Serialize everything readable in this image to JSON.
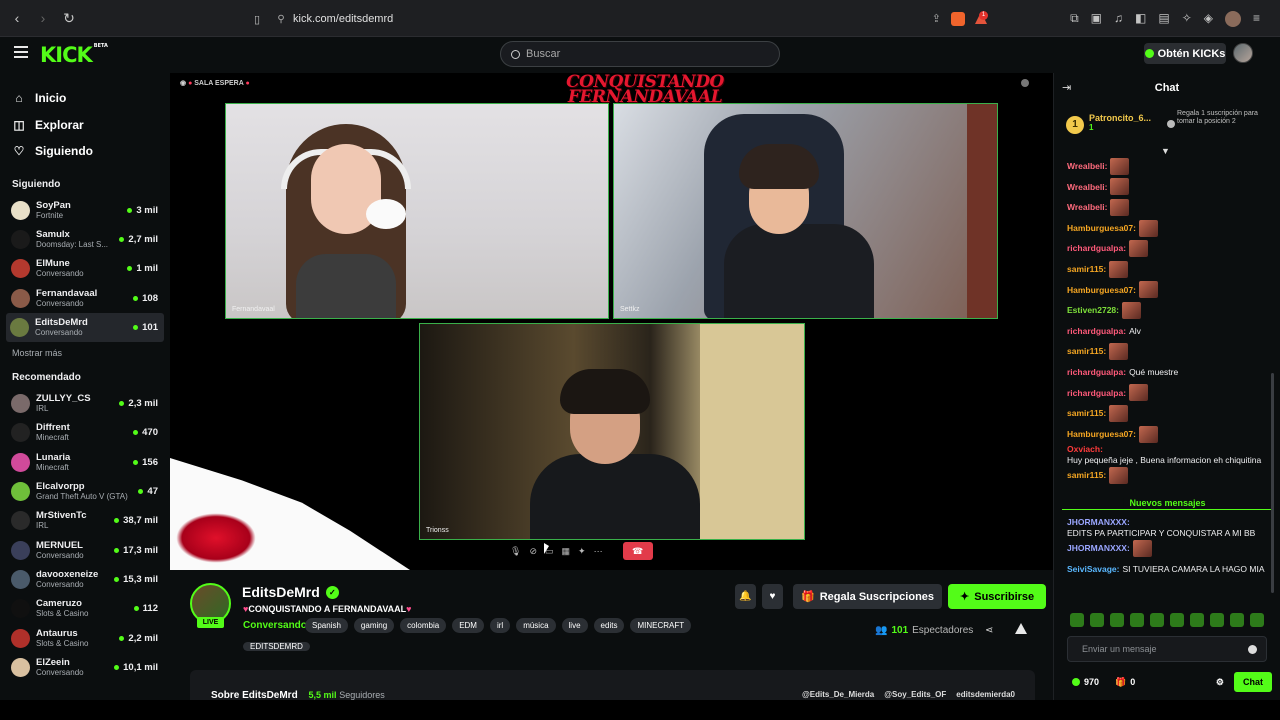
{
  "browser": {
    "url": "kick.com/editsdemrd",
    "notif_count": "1"
  },
  "header": {
    "logo": "KICK",
    "logo_beta": "BETA",
    "search_placeholder": "Buscar",
    "kicks_label": "Obtén KICKs"
  },
  "sidebar": {
    "nav": [
      {
        "label": "Inicio",
        "icon": "home-icon"
      },
      {
        "label": "Explorar",
        "icon": "compass-icon"
      },
      {
        "label": "Siguiendo",
        "icon": "heart-icon"
      }
    ],
    "following_title": "Siguiendo",
    "following": [
      {
        "name": "SoyPan",
        "category": "Fortnite",
        "viewers": "3 mil",
        "color": "#e9e0c8"
      },
      {
        "name": "Samulx",
        "category": "Doomsday: Last S...",
        "viewers": "2,7 mil",
        "color": "#1a1a1a"
      },
      {
        "name": "ElMune",
        "category": "Conversando",
        "viewers": "1 mil",
        "color": "#b3392e"
      },
      {
        "name": "Fernandavaal",
        "category": "Conversando",
        "viewers": "108",
        "color": "#8a5a48"
      },
      {
        "name": "EditsDeMrd",
        "category": "Conversando",
        "viewers": "101",
        "color": "#6a7a40"
      }
    ],
    "show_more": "Mostrar más",
    "recommended_title": "Recomendado",
    "recommended": [
      {
        "name": "ZULLYY_CS",
        "category": "IRL",
        "viewers": "2,3 mil",
        "color": "#7a6a6a"
      },
      {
        "name": "Diffrent",
        "category": "Minecraft",
        "viewers": "470",
        "color": "#222222"
      },
      {
        "name": "Lunaria",
        "category": "Minecraft",
        "viewers": "156",
        "color": "#d04a9a"
      },
      {
        "name": "Elcalvorpp",
        "category": "Grand Theft Auto V (GTA)",
        "viewers": "47",
        "color": "#6fbf3a"
      },
      {
        "name": "MrStivenTc",
        "category": "IRL",
        "viewers": "38,7 mil",
        "color": "#2a2a2a"
      },
      {
        "name": "MERNUEL",
        "category": "Conversando",
        "viewers": "17,3 mil",
        "color": "#3a3f5a"
      },
      {
        "name": "davooxeneize",
        "category": "Conversando",
        "viewers": "15,3 mil",
        "color": "#4a5a6a"
      },
      {
        "name": "Cameruzo",
        "category": "Slots & Casino",
        "viewers": "112",
        "color": "#101010"
      },
      {
        "name": "Antaurus",
        "category": "Slots & Casino",
        "viewers": "2,2 mil",
        "color": "#b0302a"
      },
      {
        "name": "ElZeein",
        "category": "Conversando",
        "viewers": "10,1 mil",
        "color": "#d9c0a0"
      }
    ]
  },
  "player": {
    "sala_label": "SALA ESPERA",
    "title_art_line1": "CONQUISTANDO",
    "title_art_line2": "FERNANDAVAAL",
    "tiles": [
      "Fernandavaal",
      "Settkz",
      "Trionss"
    ]
  },
  "channel": {
    "name": "EditsDeMrd",
    "live_label": "LIVE",
    "stream_title": "CONQUISTANDO A FERNANDAVAAL",
    "category": "Conversando",
    "tags": [
      "Spanish",
      "gaming",
      "colombia",
      "EDM",
      "irl",
      "música",
      "live",
      "edits",
      "MINECRAFT"
    ],
    "tags_row2": [
      "EDITSDEMRD"
    ],
    "gift_label": "Regala Suscripciones",
    "subscribe_label": "Suscribirse",
    "viewers_count": "101",
    "viewers_label": "Espectadores",
    "about_name": "Sobre EditsDeMrd",
    "followers_count": "5,5 mil",
    "followers_label": "Seguidores",
    "socials": [
      "@Edits_De_Mierda",
      "@Soy_Edits_OF",
      "editsdemierda0"
    ]
  },
  "chat": {
    "title": "Chat",
    "pinned_user": "Patroncito_6...",
    "pinned_rank": "1",
    "pinned_sub": "1",
    "gift_hint": "Regala 1 suscripción para tomar la posición 2",
    "messages": [
      {
        "user": "Wrealbeli",
        "color": "#ff6b7d",
        "text": "",
        "emote": true
      },
      {
        "user": "Wrealbeli",
        "color": "#ff6b7d",
        "text": "",
        "emote": true
      },
      {
        "user": "Wrealbeli",
        "color": "#ff6b7d",
        "text": "",
        "emote": true
      },
      {
        "user": "Hamburguesa07",
        "color": "#f5a623",
        "text": "",
        "emote": true
      },
      {
        "user": "richardgualpa",
        "color": "#ff5a7a",
        "text": "",
        "emote": true
      },
      {
        "user": "samir115",
        "color": "#f5a623",
        "text": "",
        "emote": true
      },
      {
        "user": "Hamburguesa07",
        "color": "#f5a623",
        "text": "",
        "emote": true
      },
      {
        "user": "Estiven2728",
        "color": "#7ee03a",
        "text": "",
        "emote": true
      },
      {
        "user": "richardgualpa",
        "color": "#ff5a7a",
        "text": "Alv",
        "emote": false
      },
      {
        "user": "samir115",
        "color": "#f5a623",
        "text": "",
        "emote": true
      },
      {
        "user": "richardgualpa",
        "color": "#ff5a7a",
        "text": "Qué muestre",
        "emote": false
      },
      {
        "user": "richardgualpa",
        "color": "#ff5a7a",
        "text": "",
        "emote": true
      },
      {
        "user": "samir115",
        "color": "#f5a623",
        "text": "",
        "emote": true
      },
      {
        "user": "Hamburguesa07",
        "color": "#f5a623",
        "text": "",
        "emote": true
      },
      {
        "user": "Oxviach",
        "color": "#ff3b3b",
        "text": "Huy pequeña jeje , Buena informacion eh chiquitina",
        "emote": false
      },
      {
        "user": "samir115",
        "color": "#f5a623",
        "text": "",
        "emote": true
      }
    ],
    "new_messages_label": "Nuevos mensajes",
    "new_messages": [
      {
        "user": "JHORMANXXX",
        "color": "#9aa6ff",
        "text": "EDITS PA PARTICIPAR Y CONQUISTAR A MI BB",
        "emote": false
      },
      {
        "user": "JHORMANXXX",
        "color": "#9aa6ff",
        "text": "",
        "emote": true
      },
      {
        "user": "SeiviSavage",
        "color": "#5ab8ff",
        "text": "SI TUVIERA CAMARA LA HAGO MIA",
        "emote": false
      }
    ],
    "input_placeholder": "Enviar un mensaje",
    "points": "970",
    "gifts": "0",
    "send_label": "Chat"
  }
}
